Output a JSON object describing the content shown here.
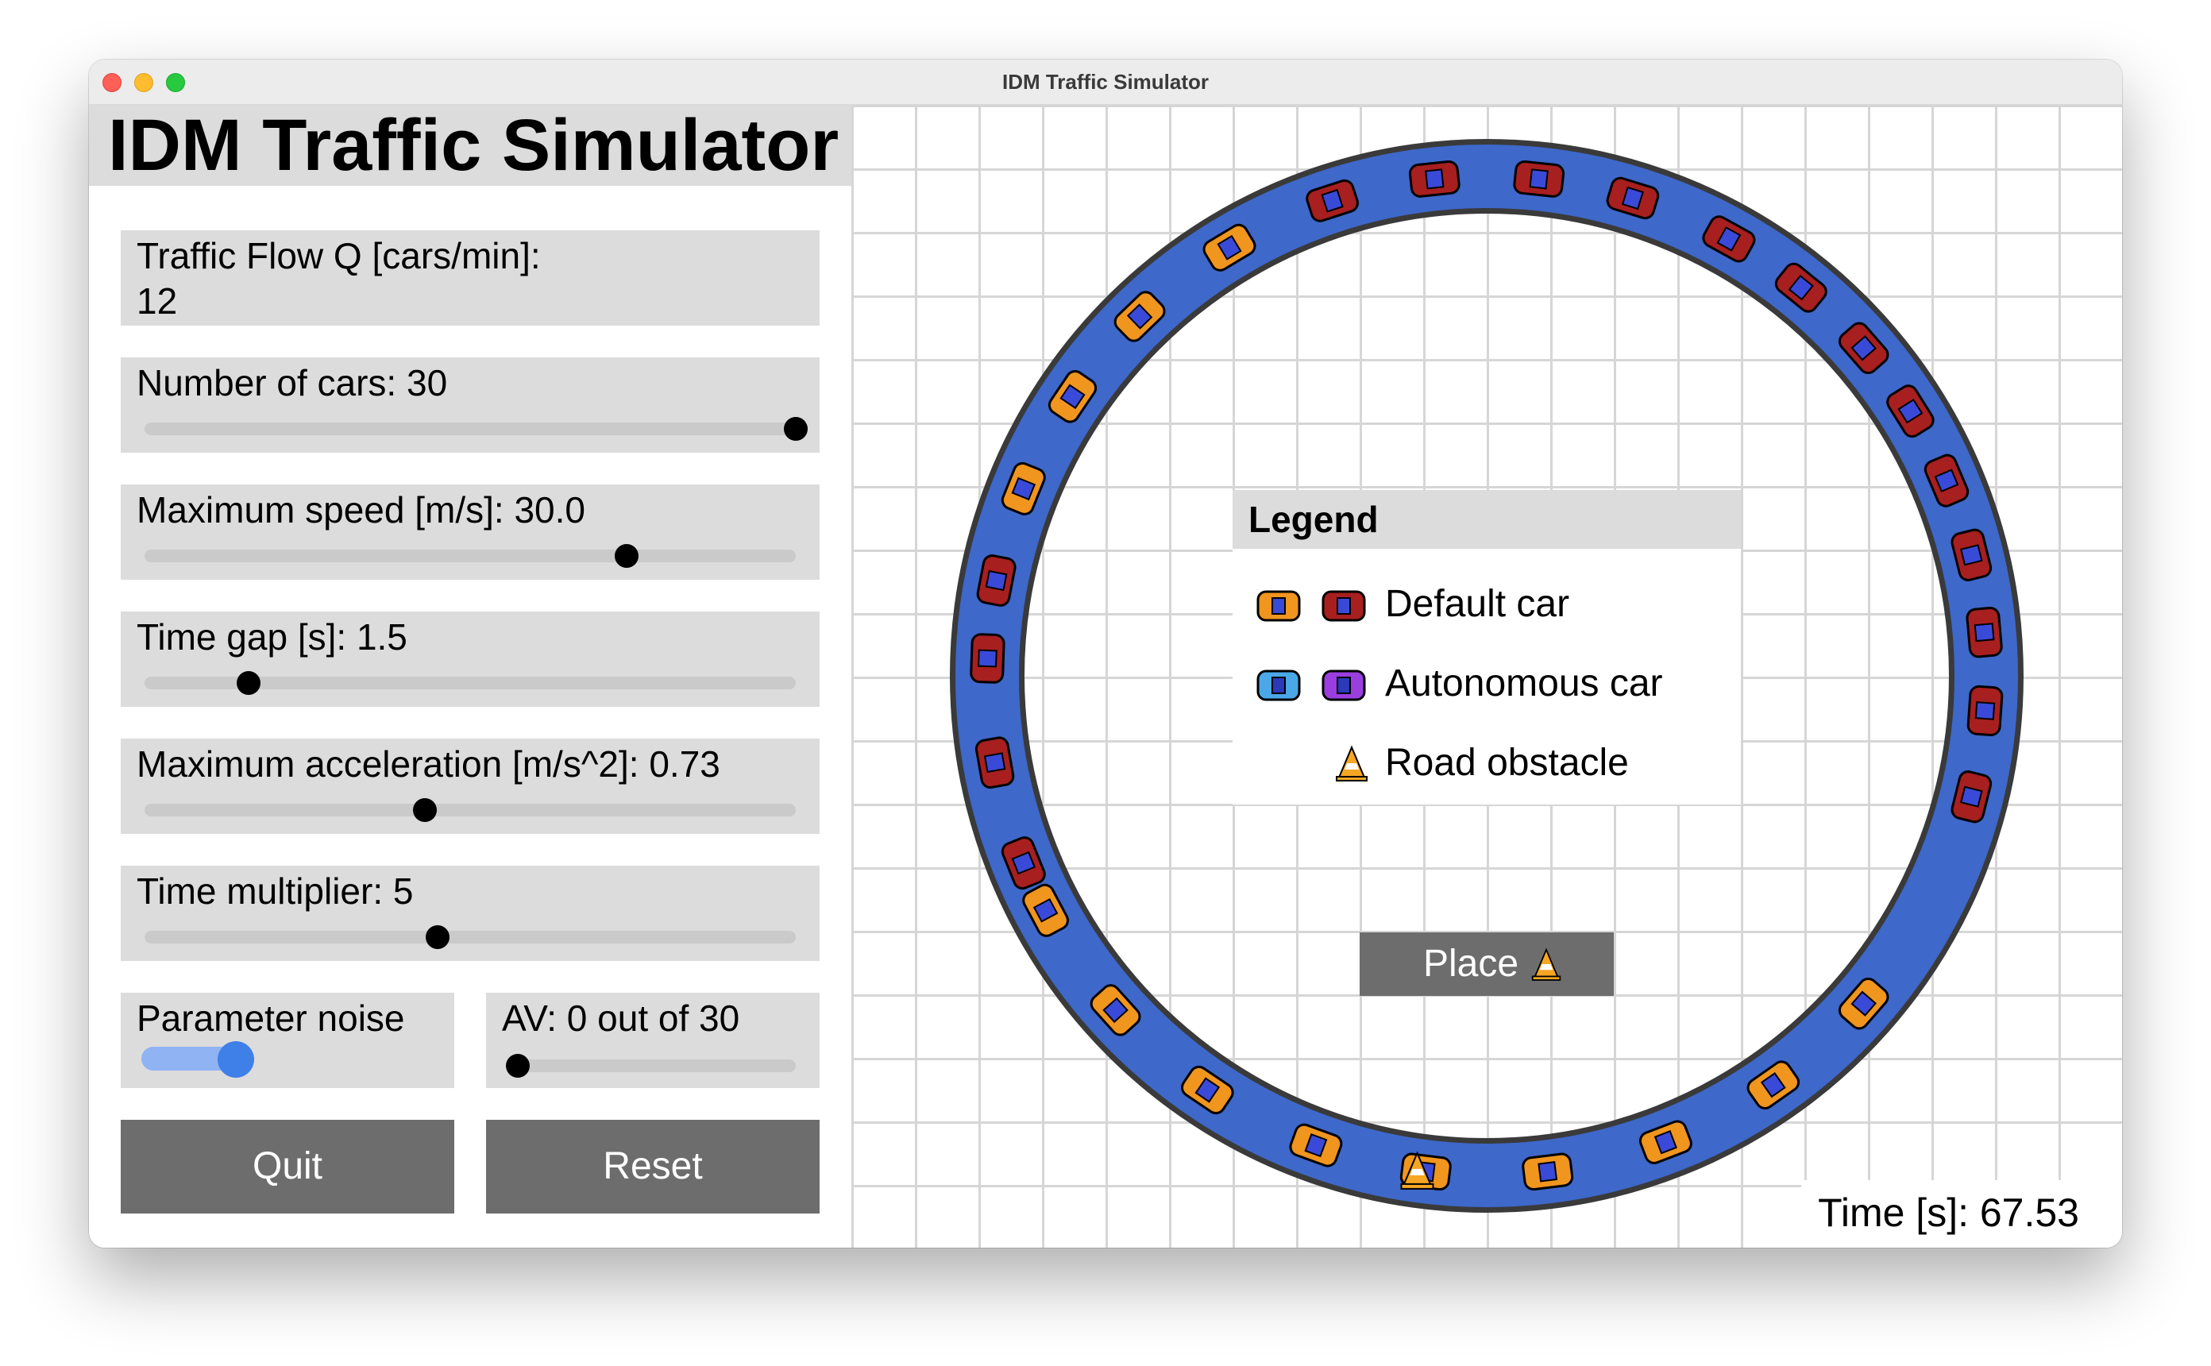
{
  "window": {
    "title": "IDM Traffic Simulator"
  },
  "app_title": "IDM Traffic Simulator",
  "traffic_flow": {
    "label": "Traffic Flow Q [cars/min]:",
    "value": "12"
  },
  "sliders": [
    {
      "label": "Number of cars: 30",
      "fraction": 1.0
    },
    {
      "label": "Maximum speed [m/s]: 30.0",
      "fraction": 0.74
    },
    {
      "label": "Time gap [s]: 1.5",
      "fraction": 0.16
    },
    {
      "label": "Maximum acceleration [m/s^2]: 0.73",
      "fraction": 0.43
    },
    {
      "label": "Time multiplier: 5",
      "fraction": 0.45
    }
  ],
  "parameter_noise": {
    "label": "Parameter noise",
    "enabled": true
  },
  "av": {
    "label": "AV: 0 out of 30",
    "fraction": 0.0
  },
  "buttons": {
    "quit": "Quit",
    "reset": "Reset"
  },
  "legend": {
    "title": "Legend",
    "items": [
      {
        "label": "Default car",
        "icons": [
          "orange-car-icon",
          "red-car-icon"
        ]
      },
      {
        "label": "Autonomous car",
        "icons": [
          "blue-car-icon",
          "purple-car-icon"
        ]
      },
      {
        "label": "Road obstacle",
        "icons": [
          "traffic-cone-icon"
        ]
      }
    ]
  },
  "place_button": {
    "label": "Place",
    "icon": "traffic-cone-icon"
  },
  "time": "Time [s]: 67.53",
  "colors": {
    "road": "#3e68c9",
    "road_edge": "#3a3a3a",
    "default_car_orange": "#f0951e",
    "default_car_red": "#a81f1f",
    "autonomous_car_blue": "#4aa8e8",
    "autonomous_car_purple": "#9a3ee0",
    "button_gray": "#6d6d6d",
    "panel_gray": "#dcdcdc",
    "toggle_blue": "#3f7fe8"
  }
}
